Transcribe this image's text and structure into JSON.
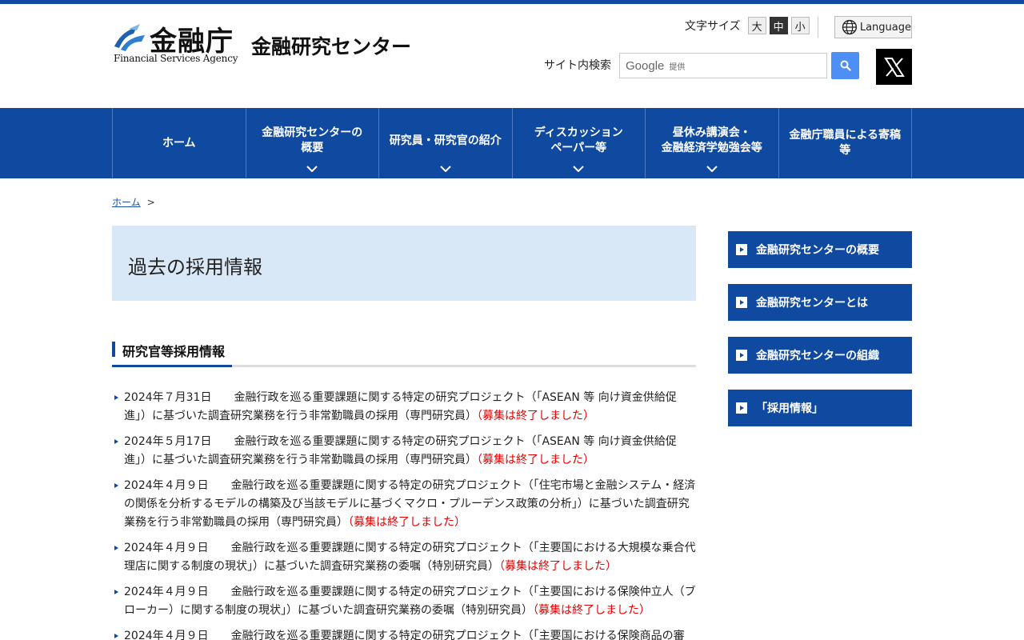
{
  "header": {
    "logo_jp": "金融庁",
    "logo_en": "Financial Services Agency",
    "center_name": "金融研究センター",
    "font_size_label": "文字サイズ",
    "font_sizes": [
      "大",
      "中",
      "小"
    ],
    "font_size_active": "中",
    "language_label": "Language",
    "search_label": "サイト内検索",
    "search_brand": "Google",
    "search_brand_suffix": "提供",
    "x_icon": "x-logo-icon"
  },
  "nav": {
    "items": [
      {
        "label": "ホーム",
        "caret": false
      },
      {
        "label": "金融研究センターの\n概要",
        "caret": true
      },
      {
        "label": "研究員・研究官の紹介",
        "caret": true
      },
      {
        "label": "ディスカッション\nペーパー等",
        "caret": true
      },
      {
        "label": "昼休み講演会・\n金融経済学勉強会等",
        "caret": true
      },
      {
        "label": "金融庁職員による寄稿\n等",
        "caret": false
      }
    ]
  },
  "breadcrumb": {
    "home": "ホーム",
    "separator": ">"
  },
  "main": {
    "page_title": "過去の採用情報",
    "section_title": "研究官等採用情報",
    "news": [
      {
        "date": "2024年７月31日",
        "text": "金融行政を巡る重要課題に関する特定の研究プロジェクト（「ASEAN 等 向け資金供給促進」）に基づいた調査研究業務を行う非常勤職員の採用（専門研究員）",
        "status": "（募集は終了しました）"
      },
      {
        "date": "2024年５月17日",
        "text": "金融行政を巡る重要課題に関する特定の研究プロジェクト（「ASEAN 等 向け資金供給促進」）に基づいた調査研究業務を行う非常勤職員の採用（専門研究員）",
        "status": "（募集は終了しました）"
      },
      {
        "date": "2024年４月９日",
        "text": "金融行政を巡る重要課題に関する特定の研究プロジェクト（「住宅市場と金融システム・経済の関係を分析するモデルの構築及び当該モデルに基づくマクロ・プルーデンス政策の分析」）に基づいた調査研究業務を行う非常勤職員の採用（専門研究員）",
        "status": "（募集は終了しました）"
      },
      {
        "date": "2024年４月９日",
        "text": "金融行政を巡る重要課題に関する特定の研究プロジェクト（「主要国における大規模な乗合代理店に関する制度の現状」）に基づいた調査研究業務の委嘱（特別研究員）",
        "status": "（募集は終了しました）"
      },
      {
        "date": "2024年４月９日",
        "text": "金融行政を巡る重要課題に関する特定の研究プロジェクト（「主要国における保険仲立人（ブローカー）に関する制度の現状」）に基づいた調査研究業務の委嘱（特別研究員）",
        "status": "（募集は終了しました）"
      },
      {
        "date": "2024年４月９日",
        "text": "金融行政を巡る重要課題に関する特定の研究プロジェクト（「主要国における保険商品の審",
        "status": ""
      }
    ]
  },
  "side_nav": {
    "items": [
      "金融研究センターの概要",
      "金融研究センターとは",
      "金融研究センターの組織",
      "「採用情報」"
    ]
  },
  "colors": {
    "brand_blue": "#0f4aa0",
    "title_bg": "#d9e8f7",
    "status_red": "#e00000",
    "search_button": "#4d8ff5"
  }
}
